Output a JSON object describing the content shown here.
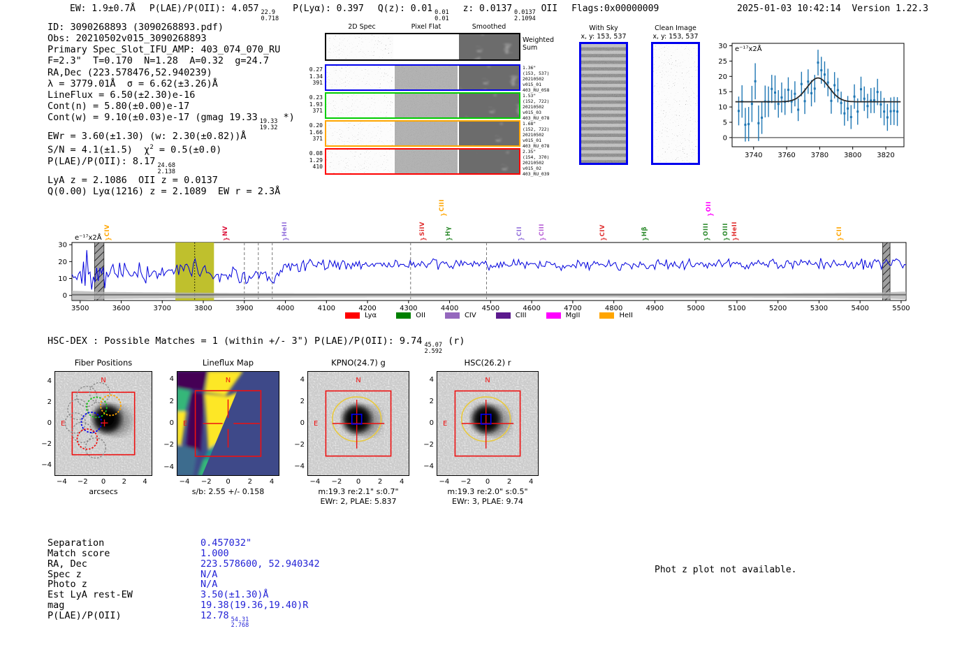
{
  "meta": {
    "timestamp": "2025-01-03 10:42:14",
    "version_label": "Version 1.22.3"
  },
  "header_segments": [
    [
      {
        "t": "EW: 1.9±0.7Å"
      }
    ],
    [
      {
        "t": "P(LAE)/P(OII): 4.057"
      },
      {
        "frac": [
          "22.9",
          "0.718"
        ]
      }
    ],
    [
      {
        "t": "P(Lyα): 0.397"
      }
    ],
    [
      {
        "t": "Q(z): 0.01"
      },
      {
        "frac": [
          "0.01",
          "0.01"
        ]
      }
    ],
    [
      {
        "t": "z: 0.0137"
      },
      {
        "frac": [
          "0.0137",
          "2.1094"
        ]
      },
      {
        "t": " OII"
      }
    ],
    [
      {
        "t": "Flags:0x00000009"
      }
    ]
  ],
  "info_lines": [
    [
      {
        "t": "ID: 3090268893 (3090268893.pdf)"
      }
    ],
    [
      {
        "t": "Obs: 20210502v015_3090268893"
      }
    ],
    [
      {
        "t": "Primary Spec_Slot_IFU_AMP: 403_074_070_RU"
      }
    ],
    [
      {
        "t": "F=2.3\"  T=0.170  N=1.28  A=0.32  g=24.7"
      }
    ],
    [
      {
        "t": "RA,Dec (223.578476,52.940239)"
      }
    ],
    [
      {
        "t": "λ = 3779.01Å  σ = 6.62(±3.26)Å"
      }
    ],
    [
      {
        "t": "LineFlux = 6.50(±2.30)e-16"
      }
    ],
    [
      {
        "t": "Cont(n) = 5.80(±0.00)e-17"
      }
    ],
    [
      {
        "t": "Cont(w) = 9.10(±0.03)e-17 (gmag 19.33"
      },
      {
        "frac": [
          "19.33",
          "19.32"
        ]
      },
      {
        "t": " *)"
      }
    ],
    [
      {
        "t": "EWr = 3.60(±1.30) (w: 2.30(±0.82))Å"
      }
    ],
    [
      {
        "t": "S/N = 4.1(±1.5)  χ"
      },
      {
        "sup": "2"
      },
      {
        "t": " = 0.5(±0.0)"
      }
    ],
    [
      {
        "t": "P(LAE)/P(OII): 8.17"
      },
      {
        "frac": [
          "24.68",
          "2.138"
        ]
      }
    ],
    [
      {
        "t": "LyA z = 2.1086  OII z = 0.0137"
      }
    ],
    [
      {
        "t": "Q(0.00) Lyα(1216) z = 2.1089  EW r = 2.3Å"
      }
    ]
  ],
  "spec2d": {
    "headers": [
      "2D Spec",
      "Pixel Flat",
      "Smoothed"
    ],
    "weighted_label": "Weighted\nSum",
    "rows": [
      {
        "color": "#0000ee",
        "left": [
          "0.27",
          "1.34",
          "391"
        ],
        "right": [
          "1.36\"",
          "(153, 537)",
          "20210502",
          "v015_01",
          "403_RU_058"
        ]
      },
      {
        "color": "#00cc00",
        "left": [
          "0.23",
          "1.93",
          "371"
        ],
        "right": [
          "1.53\"",
          "(152, 722)",
          "20210502",
          "v015_03",
          "403_RU_078"
        ]
      },
      {
        "color": "#ffa500",
        "left": [
          "0.20",
          "1.66",
          "371"
        ],
        "right": [
          "1.68\"",
          "(152, 722)",
          "20210502",
          "v015_01",
          "403_RU_078"
        ]
      },
      {
        "color": "#ff0000",
        "left": [
          "0.08",
          "1.29",
          "410"
        ],
        "right": [
          "2.35\"",
          "(154, 370)",
          "20210502",
          "v015_02",
          "403_RU_039"
        ]
      }
    ]
  },
  "sky_panels": [
    {
      "title": "With Sky",
      "coords": "x, y: 153, 537"
    },
    {
      "title": "Clean Image",
      "coords": "x, y: 153, 537"
    }
  ],
  "chart_data": [
    {
      "type": "scatter",
      "name": "line_fit_plot",
      "ylabel_inside": "e⁻¹⁷x2Å",
      "xticks": [
        3740,
        3760,
        3780,
        3800,
        3820
      ],
      "yticks": [
        0,
        5,
        10,
        15,
        20,
        25,
        30
      ],
      "xlim": [
        3727,
        3831
      ],
      "ylim": [
        -3,
        30.8
      ],
      "fit": {
        "center": 3779.01,
        "sigma": 6.62,
        "continuum": 11.7,
        "peak": 19.5
      },
      "points": [
        [
          3731,
          8.7,
          4.7
        ],
        [
          3733,
          11.8,
          5.3
        ],
        [
          3735,
          4.2,
          5.5
        ],
        [
          3737,
          4.4,
          5.6
        ],
        [
          3739,
          11.0,
          5.9
        ],
        [
          3741,
          18.4,
          5.9
        ],
        [
          3743,
          4.7,
          5.8
        ],
        [
          3745,
          6.5,
          5.3
        ],
        [
          3747,
          11.8,
          5.2
        ],
        [
          3749,
          11.7,
          5.0
        ],
        [
          3751,
          15.9,
          4.6
        ],
        [
          3753,
          14.7,
          5.6
        ],
        [
          3755,
          11.0,
          4.5
        ],
        [
          3757,
          13.1,
          4.9
        ],
        [
          3759,
          11.7,
          4.3
        ],
        [
          3761,
          15.6,
          4.1
        ],
        [
          3763,
          11.8,
          3.8
        ],
        [
          3765,
          14.3,
          4.1
        ],
        [
          3767,
          9.1,
          3.7
        ],
        [
          3769,
          17.5,
          4.0
        ],
        [
          3771,
          11.9,
          4.2
        ],
        [
          3773,
          18.3,
          4.0
        ],
        [
          3775,
          14.5,
          4.3
        ],
        [
          3777,
          16.0,
          4.5
        ],
        [
          3779,
          24.5,
          4.2
        ],
        [
          3781,
          22.0,
          4.4
        ],
        [
          3783,
          20.6,
          4.3
        ],
        [
          3785,
          18.0,
          4.5
        ],
        [
          3787,
          12.0,
          4.2
        ],
        [
          3789,
          17.1,
          4.3
        ],
        [
          3791,
          15.5,
          4.0
        ],
        [
          3793,
          11.3,
          3.7
        ],
        [
          3795,
          7.9,
          4.0
        ],
        [
          3797,
          9.5,
          4.1
        ],
        [
          3799,
          6.7,
          3.9
        ],
        [
          3801,
          13.4,
          4.0
        ],
        [
          3803,
          8.5,
          4.3
        ],
        [
          3805,
          15.8,
          4.1
        ],
        [
          3807,
          12.7,
          4.0
        ],
        [
          3809,
          10.3,
          4.0
        ],
        [
          3811,
          12.1,
          4.1
        ],
        [
          3813,
          12.2,
          4.2
        ],
        [
          3815,
          14.9,
          4.3
        ],
        [
          3817,
          10.8,
          4.4
        ],
        [
          3819,
          8.5,
          4.5
        ],
        [
          3821,
          6.6,
          4.4
        ],
        [
          3823,
          8.6,
          4.5
        ],
        [
          3825,
          8.7,
          4.6
        ],
        [
          3827,
          8.5,
          4.7
        ]
      ]
    },
    {
      "type": "line",
      "name": "full_spectrum",
      "ylabel_inside": "e⁻¹⁷x2Å",
      "xticks": [
        3500,
        3600,
        3700,
        3800,
        3900,
        4000,
        4100,
        4200,
        4300,
        4400,
        4500,
        4600,
        4700,
        4800,
        4900,
        5000,
        5100,
        5200,
        5300,
        5400,
        5500
      ],
      "yticks": [
        0,
        10,
        20,
        30
      ],
      "xlim": [
        3480,
        5512
      ],
      "ylim": [
        -3,
        31.3
      ],
      "highlight_band": [
        3732,
        3826
      ],
      "line_center": 3779.01,
      "masked_bands": [
        [
          3535,
          3558
        ],
        [
          5455,
          5473
        ]
      ],
      "dashed_lines": [
        3900,
        3934,
        3968,
        4305,
        4490
      ],
      "envelope_keypoints": [
        [
          3480,
          12,
          8
        ],
        [
          3560,
          13,
          8
        ],
        [
          3650,
          13,
          6.5
        ],
        [
          3730,
          13,
          4
        ],
        [
          3779,
          17,
          4.5
        ],
        [
          3830,
          12,
          4
        ],
        [
          3880,
          13,
          4.5
        ],
        [
          3915,
          9,
          4.5
        ],
        [
          3940,
          12,
          5
        ],
        [
          3968,
          7,
          3.5
        ],
        [
          3995,
          16,
          4
        ],
        [
          4060,
          19,
          3.5
        ],
        [
          4150,
          18,
          3
        ],
        [
          4250,
          18.5,
          3
        ],
        [
          4350,
          18,
          3
        ],
        [
          4450,
          18.5,
          3.2
        ],
        [
          4550,
          18,
          3
        ],
        [
          4700,
          18,
          3
        ],
        [
          4900,
          18,
          3
        ],
        [
          5100,
          18.5,
          3
        ],
        [
          5300,
          18.5,
          3
        ],
        [
          5460,
          18.5,
          3.2
        ],
        [
          5512,
          18.5,
          3
        ]
      ],
      "noise_halfwidth_keypoints": [
        [
          3480,
          2.8
        ],
        [
          3550,
          2.1
        ],
        [
          3700,
          1.8
        ],
        [
          3900,
          1.4
        ],
        [
          4200,
          1.2
        ],
        [
          4800,
          1.2
        ],
        [
          5200,
          1.3
        ],
        [
          5450,
          1.7
        ],
        [
          5512,
          2.3
        ]
      ],
      "noise_seed": 42
    }
  ],
  "emission_lines": [
    {
      "label": "CIV",
      "wave": 3570,
      "color": "#ffa500",
      "tier": 0
    },
    {
      "label": "NV",
      "wave": 3857,
      "color": "#dc143c",
      "tier": 0
    },
    {
      "label": "HeII",
      "wave": 4002,
      "color": "#9370db",
      "tier": 0
    },
    {
      "label": "SiIV",
      "wave": 4337,
      "color": "#e03030",
      "tier": 0
    },
    {
      "label": "CIII",
      "wave": 4386,
      "color": "#ffa500",
      "tier": 1
    },
    {
      "label": "Hγ",
      "wave": 4400,
      "color": "#2e8b2e",
      "tier": 0
    },
    {
      "label": "CII",
      "wave": 4575,
      "color": "#9370db",
      "tier": 0
    },
    {
      "label": "CIII",
      "wave": 4628,
      "color": "#b75fd6",
      "tier": 0
    },
    {
      "label": "CIV",
      "wave": 4776,
      "color": "#e03030",
      "tier": 0
    },
    {
      "label": "Hβ",
      "wave": 4879,
      "color": "#2e8b2e",
      "tier": 0
    },
    {
      "label": "OIII",
      "wave": 5028,
      "color": "#2e8b2e",
      "tier": 0
    },
    {
      "label": "OII",
      "wave": 5036,
      "color": "#ff00ff",
      "tier": 1
    },
    {
      "label": "OIII",
      "wave": 5076,
      "color": "#2e8b2e",
      "tier": 0
    },
    {
      "label": "HeII",
      "wave": 5098,
      "color": "#e03030",
      "tier": 0
    },
    {
      "label": "CII",
      "wave": 5354,
      "color": "#ffa500",
      "tier": 0
    }
  ],
  "legend": [
    {
      "label": "Lyα",
      "color": "#ff0000"
    },
    {
      "label": "OII",
      "color": "#008000"
    },
    {
      "label": "CIV",
      "color": "#9467bd"
    },
    {
      "label": "CIII",
      "color": "#5c1a8e"
    },
    {
      "label": "MgII",
      "color": "#ff00ff"
    },
    {
      "label": "HeII",
      "color": "#ffa500"
    }
  ],
  "hsc_dex_segments": [
    {
      "t": "HSC-DEX : Possible Matches = 1 (within +/- 3\")  P(LAE)/P(OII): 9.74"
    },
    {
      "frac": [
        "45.07",
        "2.592"
      ]
    },
    {
      "t": " (r)"
    }
  ],
  "cutouts": [
    {
      "title": "Fiber Positions",
      "xlabel": "arcsecs",
      "captions": [],
      "fibers": {
        "gray": [
          [
            -1.6,
            2.6
          ],
          [
            -0.35,
            2.95
          ],
          [
            -2.45,
            1.35
          ],
          [
            -2.7,
            0.05
          ],
          [
            -2.05,
            -0.85
          ],
          [
            -0.75,
            -2.35
          ]
        ],
        "green": [
          -0.65,
          1.55
        ],
        "orange": [
          0.7,
          1.75
        ],
        "blue": [
          -1.15,
          0.1
        ],
        "red": [
          -1.55,
          -1.5
        ],
        "radius_arcsec": 0.72
      }
    },
    {
      "title": "Lineflux Map",
      "xlabel": "s/b: 2.55 +/- 0.158",
      "captions": []
    },
    {
      "title": "KPNO(24.7) g",
      "xlabel": "m:19.3 re:2.1\" s:0.7\"",
      "captions": [
        "EWr: 2, PLAE: 5.837"
      ]
    },
    {
      "title": "HSC(26.2) r",
      "xlabel": "m:19.3 re:2.0\" s:0.5\"",
      "captions": [
        "EWr: 3, PLAE: 9.74"
      ]
    }
  ],
  "cutout_axis": {
    "ticks": [
      -4,
      -2,
      0,
      2,
      4
    ],
    "compass_n": "N",
    "compass_e": "E"
  },
  "match_table": [
    {
      "label": "Separation",
      "value": "0.457032\""
    },
    {
      "label": "Match score",
      "value": "1.000"
    },
    {
      "label": "RA, Dec",
      "value": "223.578600, 52.940342"
    },
    {
      "label": "Spec z",
      "value": "N/A"
    },
    {
      "label": "Photo z",
      "value": "N/A"
    },
    {
      "label": "Est LyA rest-EW",
      "value": "3.50(±1.30)Å"
    },
    {
      "label": "mag",
      "value": "19.38(19.36,19.40)R"
    },
    {
      "label": "P(LAE)/P(OII)",
      "value": "12.78",
      "frac": [
        "54.31",
        "2.768"
      ]
    }
  ],
  "photz_note": "Phot z plot not available.",
  "colors": {
    "spectrum_blue": "#0000dd",
    "fit_point_blue": "#1f77b4",
    "highlight_olive": "#bcbd22",
    "value_blue": "#2323d6",
    "marker_red": "#ee1111",
    "aperture_yellow": "#e8c93f",
    "flux_bg": "#3e4989"
  }
}
